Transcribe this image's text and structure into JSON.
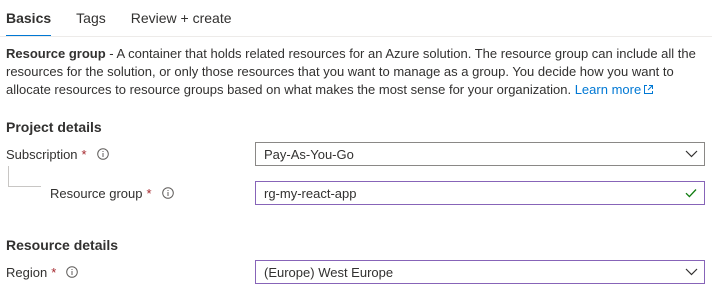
{
  "tabs": [
    {
      "label": "Basics",
      "active": true
    },
    {
      "label": "Tags",
      "active": false
    },
    {
      "label": "Review + create",
      "active": false
    }
  ],
  "intro": {
    "term": "Resource group",
    "text": " - A container that holds related resources for an Azure solution. The resource group can include all the resources for the solution, or only those resources that you want to manage as a group. You decide how you want to allocate resources to resource groups based on what makes the most sense for your organization. ",
    "learn_more": "Learn more",
    "learn_more_icon": "external-link-icon"
  },
  "project_details": {
    "title": "Project details",
    "subscription": {
      "label": "Subscription",
      "required": "*",
      "value": "Pay-As-You-Go",
      "icon": "chevron-down-icon"
    },
    "resource_group": {
      "label": "Resource group",
      "required": "*",
      "value": "rg-my-react-app",
      "icon": "checkmark-icon"
    }
  },
  "resource_details": {
    "title": "Resource details",
    "region": {
      "label": "Region",
      "required": "*",
      "value": "(Europe) West Europe",
      "icon": "chevron-down-icon"
    }
  },
  "colors": {
    "accent": "#0078d4",
    "required": "#a4262c",
    "valid": "#107c10",
    "validated_border": "#8764b8",
    "text": "#323130"
  }
}
